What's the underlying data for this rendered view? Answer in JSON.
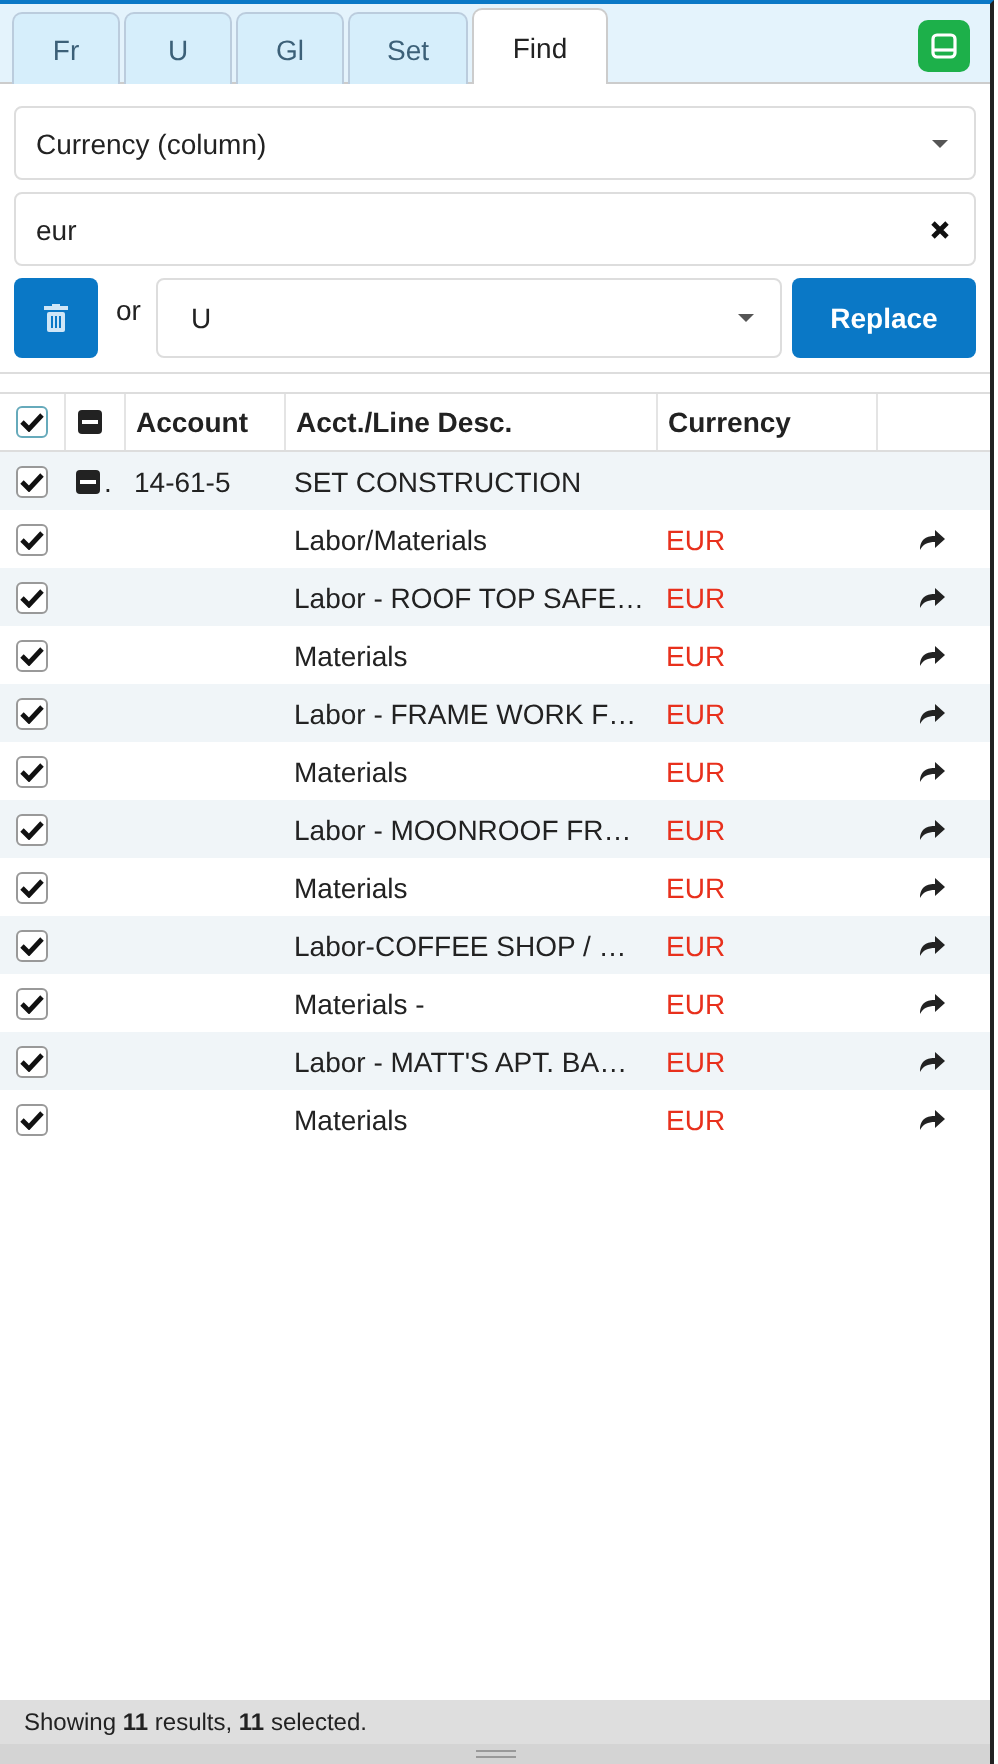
{
  "tabs": [
    {
      "label": "Fr",
      "selected": false
    },
    {
      "label": "U",
      "selected": false
    },
    {
      "label": "Gl",
      "selected": false
    },
    {
      "label": "Set",
      "selected": false
    },
    {
      "label": "Find",
      "selected": true
    }
  ],
  "find": {
    "column": "Currency (column)",
    "search": "eur",
    "or_label": "or",
    "replace_value": "U",
    "replace_button": "Replace"
  },
  "table": {
    "all_checked": true,
    "all_expanded": true,
    "columns": [
      "Account",
      "Acct./Line Desc.",
      "Currency"
    ],
    "group": {
      "checked": true,
      "expanded": true,
      "marker": ".",
      "account": "14-61-5",
      "description": "SET CONSTRUCTION"
    },
    "rows": [
      {
        "checked": true,
        "description": "Labor/Materials",
        "currency": "EUR"
      },
      {
        "checked": true,
        "description": "Labor - ROOF TOP SAFE…",
        "currency": "EUR"
      },
      {
        "checked": true,
        "description": "Materials",
        "currency": "EUR"
      },
      {
        "checked": true,
        "description": "Labor - FRAME WORK F…",
        "currency": "EUR"
      },
      {
        "checked": true,
        "description": "Materials",
        "currency": "EUR"
      },
      {
        "checked": true,
        "description": "Labor - MOONROOF FR…",
        "currency": "EUR"
      },
      {
        "checked": true,
        "description": "Materials",
        "currency": "EUR"
      },
      {
        "checked": true,
        "description": "Labor-COFFEE SHOP / …",
        "currency": "EUR"
      },
      {
        "checked": true,
        "description": "Materials -",
        "currency": "EUR"
      },
      {
        "checked": true,
        "description": "Labor - MATT'S APT. BA…",
        "currency": "EUR"
      },
      {
        "checked": true,
        "description": "Materials",
        "currency": "EUR"
      }
    ]
  },
  "status_bar": "Showing **11** results, **11** selected."
}
